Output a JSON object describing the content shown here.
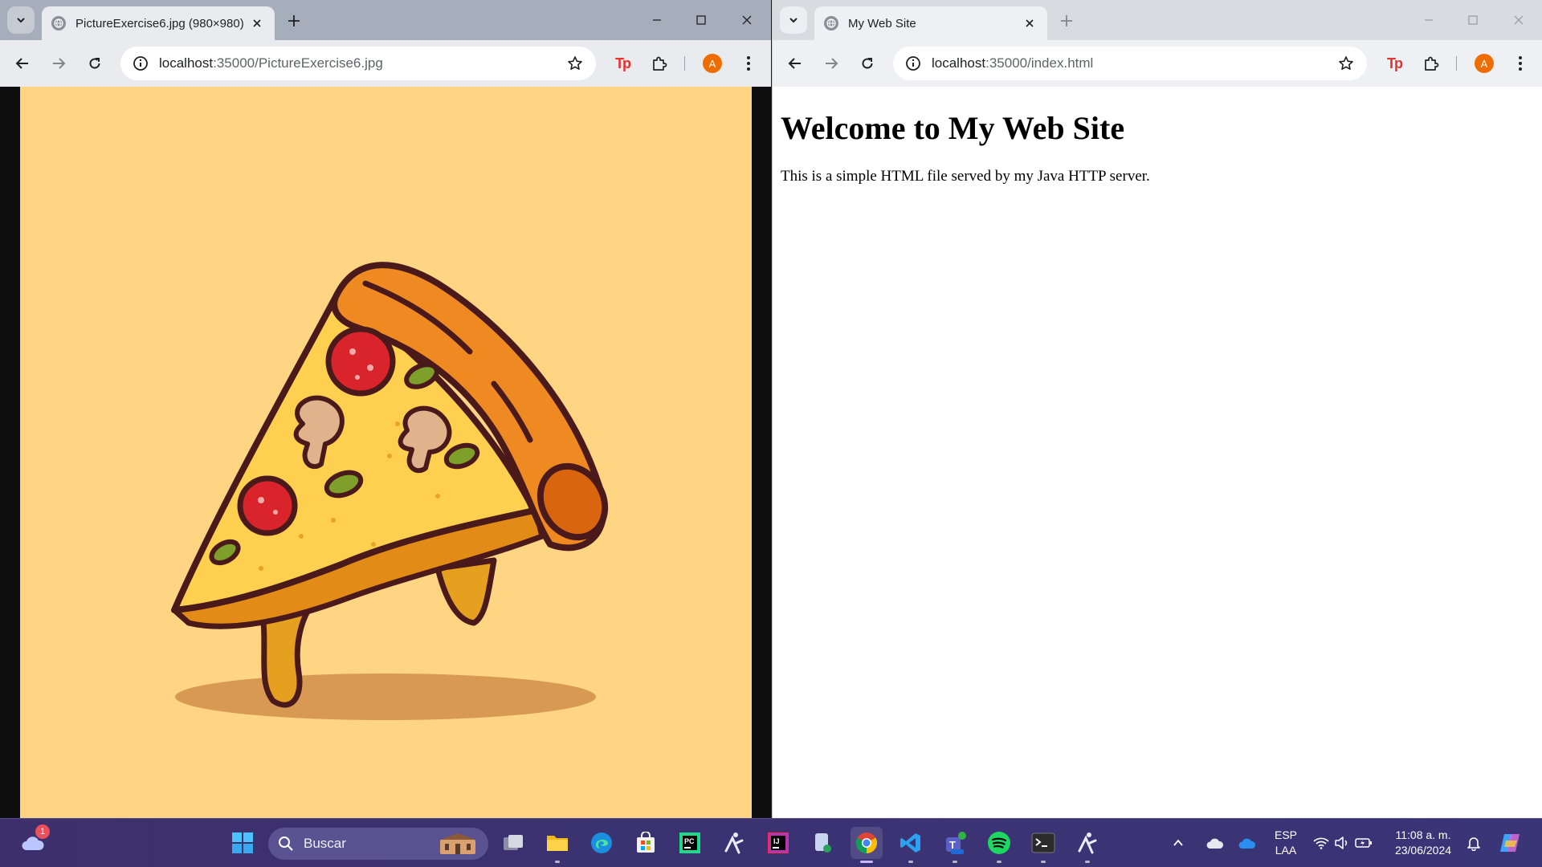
{
  "left_window": {
    "tab_title": "PictureExercise6.jpg (980×980)",
    "url_host": "localhost",
    "url_path": ":35000/PictureExercise6.jpg",
    "profile_initial": "A"
  },
  "right_window": {
    "tab_title": "My Web Site",
    "url_host": "localhost",
    "url_path": ":35000/index.html",
    "profile_initial": "A",
    "page": {
      "heading": "Welcome to My Web Site",
      "paragraph": "This is a simple HTML file served by my Java HTTP server."
    }
  },
  "image": {
    "subject": "pizza slice illustration",
    "background_color": "#ffd584"
  },
  "taskbar": {
    "weather_badge": "1",
    "search_placeholder": "Buscar",
    "apps": [
      "task-view",
      "file-explorer",
      "edge",
      "microsoft-store",
      "pycharm",
      "accessibility-app",
      "intellij",
      "files-app",
      "chrome",
      "vscode",
      "teams",
      "spotify",
      "terminal",
      "accessibility-app-2"
    ],
    "language_line1": "ESP",
    "language_line2": "LAA",
    "time": "11:08 a. m.",
    "date": "23/06/2024"
  },
  "colors": {
    "accent_chrome_profile": "#ef6c00",
    "tp_extension": "#e5322d"
  }
}
